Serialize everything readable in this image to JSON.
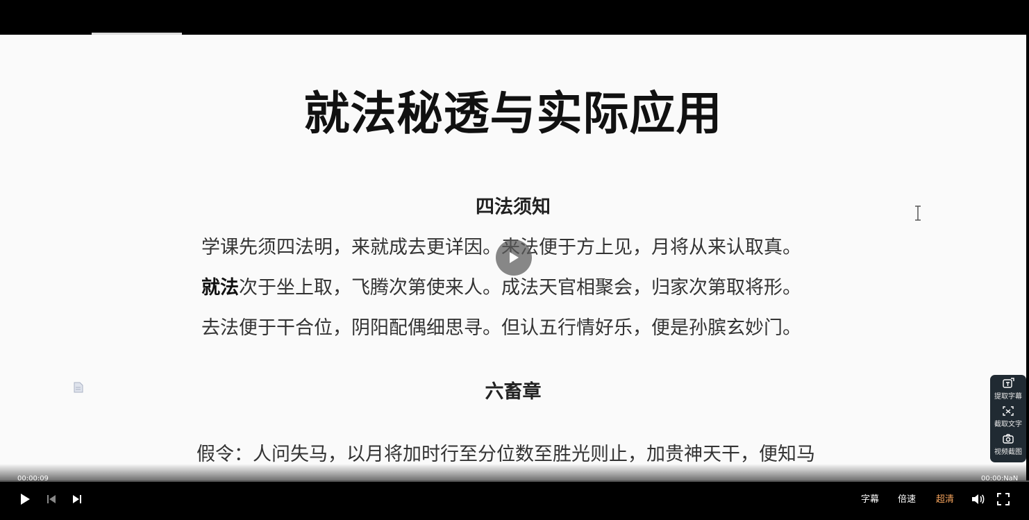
{
  "document": {
    "title": "就法秘透与实际应用",
    "section1_heading": "四法须知",
    "poem_line1": "学课先须四法明，来就成去更详因。来法便于方上见，月将从来认取真。",
    "poem_line2_bold": "就法",
    "poem_line2_rest": "次于坐上取，飞腾次第使来人。成法天官相聚会，归家次第取将形。",
    "poem_line3": "去法便于干合位，阴阳配偶细思寻。但认五行情好乐，便是孙膑玄妙门。",
    "section2_heading": "六畜章",
    "prose_line1": "假令：人问失马，以月将加时行至分位数至胜光则止，加贵神天干，便知马"
  },
  "side_tools": {
    "extract_subtitles": "提取字幕",
    "capture_text": "截取文字",
    "video_screenshot": "视频截图"
  },
  "player": {
    "current_time": "00:00:09",
    "total_time": "00:00:NaN",
    "subtitles_label": "字幕",
    "speed_label": "倍速",
    "quality_label": "超清",
    "accent_color": "#f5a35c"
  }
}
